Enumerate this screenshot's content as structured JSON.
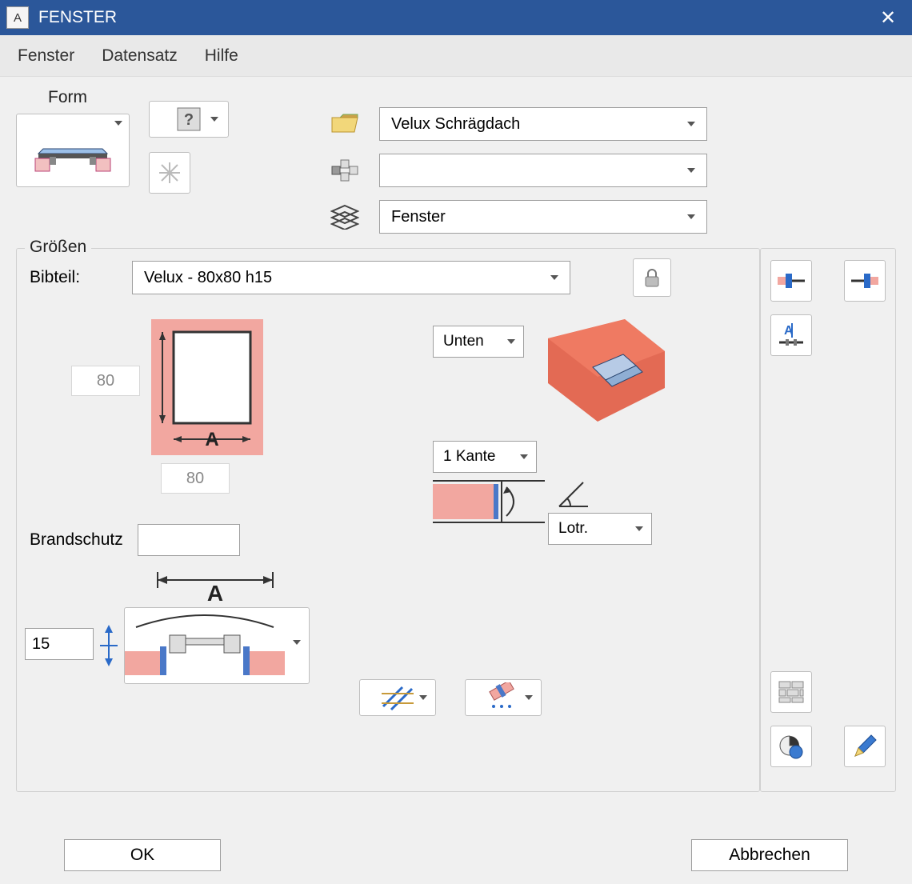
{
  "window": {
    "title": "FENSTER"
  },
  "menu": {
    "items": [
      "Fenster",
      "Datensatz",
      "Hilfe"
    ]
  },
  "form": {
    "label": "Form"
  },
  "combos": {
    "folder": "Velux Schrägdach",
    "group": "",
    "layer": "Fenster"
  },
  "group": {
    "legend": "Größen",
    "bibteil_label": "Bibteil:",
    "bibteil_value": "Velux - 80x80 h15",
    "dim_h": "80",
    "dim_w": "80",
    "brand_label": "Brandschutz",
    "brand_value": "",
    "height_value": "15",
    "side_sel": "Unten",
    "edge_sel": "1 Kante",
    "angle_sel": "Lotr.",
    "a_label": "A"
  },
  "footer": {
    "ok": "OK",
    "cancel": "Abbrechen"
  }
}
